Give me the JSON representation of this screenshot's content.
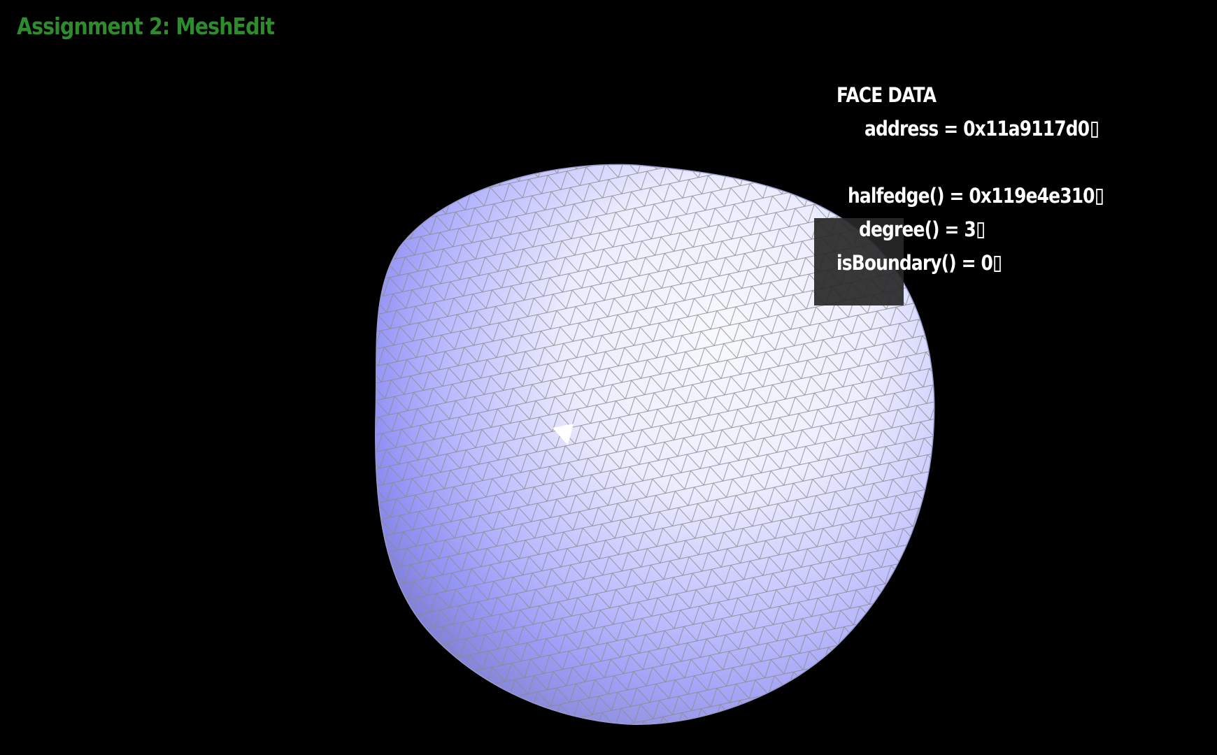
{
  "app": {
    "title": "Assignment 2: MeshEdit",
    "title_color": "#2e8b2e"
  },
  "face_data": {
    "heading": "FACE DATA",
    "address": "address = 0x11a9117d0",
    "halfedge": "halfedge() = 0x119e4e310",
    "degree": "degree() = 3",
    "is_boundary": "isBoundary() = 0",
    "trailing_glyph": "box-glyph"
  },
  "mesh": {
    "base_color": "#9090ff",
    "highlight_color": "#ffffff",
    "wire_color": "#8a8a8a",
    "selected_face_color": "#ffffff"
  }
}
